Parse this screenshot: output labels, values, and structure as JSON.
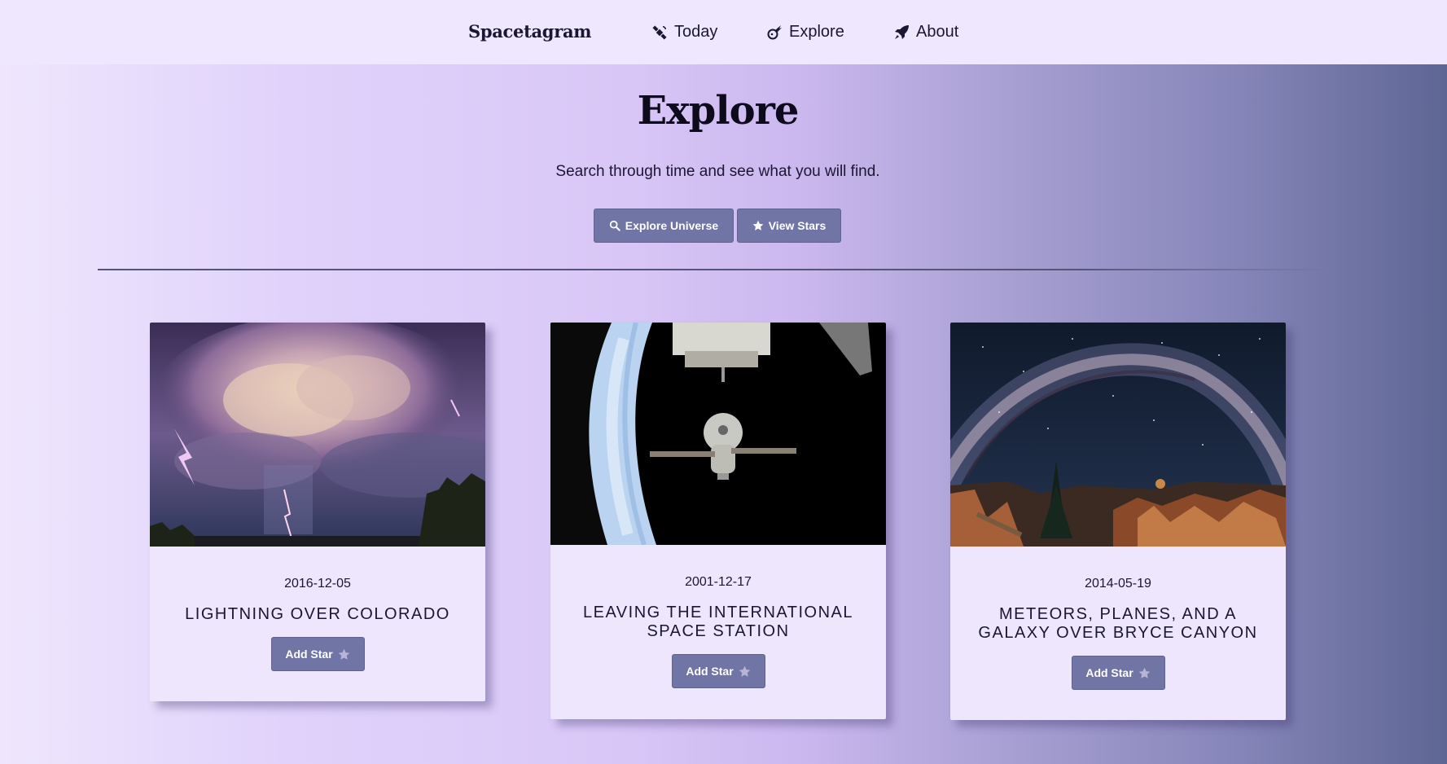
{
  "nav": {
    "brand": "Spacetagram",
    "links": [
      {
        "label": "Today",
        "icon": "satellite-icon"
      },
      {
        "label": "Explore",
        "icon": "meteor-icon"
      },
      {
        "label": "About",
        "icon": "rocket-icon"
      }
    ]
  },
  "hero": {
    "title": "Explore",
    "subtitle": "Search through time and see what you will find.",
    "explore_button": "Explore Universe",
    "stars_button": "View Stars"
  },
  "cards": [
    {
      "date": "2016-12-05",
      "title": "LIGHTNING OVER COLORADO",
      "button": "Add Star"
    },
    {
      "date": "2001-12-17",
      "title": "LEAVING THE INTERNATIONAL SPACE STATION",
      "button": "Add Star"
    },
    {
      "date": "2014-05-19",
      "title": "METEORS, PLANES, AND A GALAXY OVER BRYCE CANYON",
      "button": "Add Star"
    }
  ],
  "colors": {
    "button": "#7175a6",
    "nav_bg": "#efe7fd",
    "card_bg": "#eee6fd"
  }
}
